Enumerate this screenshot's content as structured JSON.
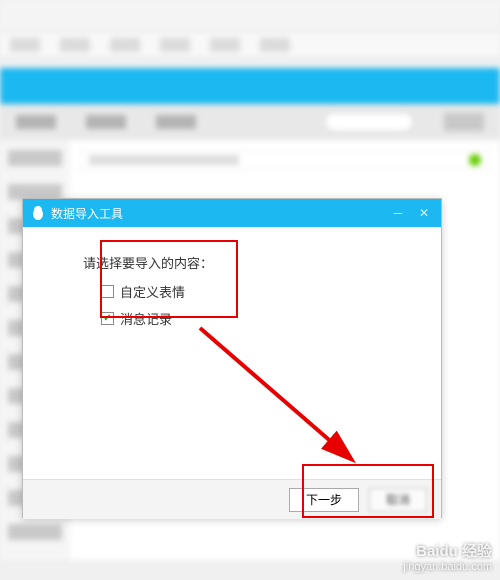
{
  "dialog": {
    "title": "数据导入工具",
    "prompt": "请选择要导入的内容：",
    "options": [
      {
        "label": "自定义表情",
        "checked": false
      },
      {
        "label": "消息记录",
        "checked": true
      }
    ],
    "next_label": "下一步",
    "cancel_label": "取消"
  },
  "watermark": {
    "brand": "Baidu 经验",
    "url": "jingyan.baidu.com"
  }
}
